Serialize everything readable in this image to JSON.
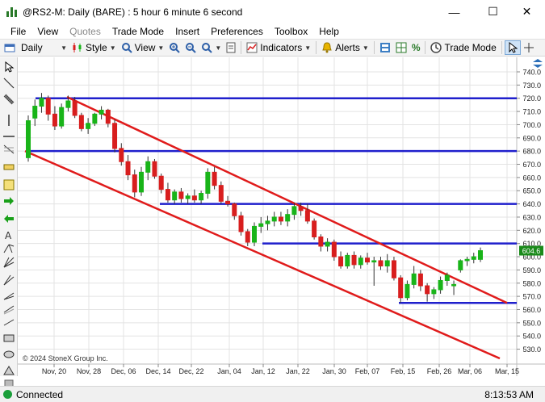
{
  "window": {
    "title": "@RS2-M: Daily (BARE) : 5 hour 6 minute 6 second",
    "minimize": "—",
    "maximize": "☐",
    "close": "✕"
  },
  "menu": [
    {
      "label": "File",
      "disabled": false
    },
    {
      "label": "View",
      "disabled": false
    },
    {
      "label": "Quotes",
      "disabled": true
    },
    {
      "label": "Trade Mode",
      "disabled": false
    },
    {
      "label": "Insert",
      "disabled": false
    },
    {
      "label": "Preferences",
      "disabled": false
    },
    {
      "label": "Toolbox",
      "disabled": false
    },
    {
      "label": "Help",
      "disabled": false
    }
  ],
  "toolbar": {
    "interval": "Daily",
    "style": "Style",
    "view": "View",
    "indicators": "Indicators",
    "alerts": "Alerts",
    "trade_mode": "Trade Mode"
  },
  "chart": {
    "copyright": "© 2024 StoneX Group Inc.",
    "last_price_label": "604.6",
    "colors": {
      "up": "#19b419",
      "down": "#d81e1e",
      "support_resistance": "#1f1fcc",
      "channel": "#e01b1b",
      "price_tag": "#1a8a1a"
    },
    "price_ticks": [
      "740.0",
      "730.0",
      "720.0",
      "710.0",
      "700.0",
      "690.0",
      "680.0",
      "670.0",
      "660.0",
      "650.0",
      "640.0",
      "630.0",
      "620.0",
      "610.0",
      "600.0",
      "590.0",
      "580.0",
      "570.0",
      "560.0",
      "550.0",
      "540.0",
      "530.0"
    ],
    "date_labels": [
      "Nov, 20",
      "Nov, 28",
      "Dec, 06",
      "Dec, 14",
      "Dec, 22",
      "Jan, 04",
      "Jan, 12",
      "Jan, 22",
      "Jan, 30",
      "Feb, 07",
      "Feb, 15",
      "Feb, 26",
      "Mar, 06",
      "Mar, 15"
    ]
  },
  "chart_data": {
    "type": "candlestick",
    "ylim": [
      525,
      745
    ],
    "horizontal_levels": [
      720,
      680,
      640,
      610,
      565
    ],
    "channel_lines": [
      {
        "from": [
          "Nov, 23",
          721
        ],
        "to": [
          "Mar, 15",
          565
        ]
      },
      {
        "from": [
          "Nov, 16",
          680
        ],
        "to": [
          "Mar, 13",
          523
        ]
      }
    ],
    "candles": [
      {
        "o": 675,
        "h": 707,
        "l": 672,
        "c": 703
      },
      {
        "o": 705,
        "h": 719,
        "l": 699,
        "c": 714
      },
      {
        "o": 714,
        "h": 724,
        "l": 709,
        "c": 720
      },
      {
        "o": 720,
        "h": 722,
        "l": 703,
        "c": 708
      },
      {
        "o": 708,
        "h": 714,
        "l": 696,
        "c": 699
      },
      {
        "o": 699,
        "h": 716,
        "l": 697,
        "c": 713
      },
      {
        "o": 713,
        "h": 722,
        "l": 710,
        "c": 718
      },
      {
        "o": 718,
        "h": 721,
        "l": 705,
        "c": 707
      },
      {
        "o": 707,
        "h": 709,
        "l": 695,
        "c": 697
      },
      {
        "o": 697,
        "h": 705,
        "l": 693,
        "c": 701
      },
      {
        "o": 701,
        "h": 709,
        "l": 699,
        "c": 708
      },
      {
        "o": 708,
        "h": 714,
        "l": 704,
        "c": 711
      },
      {
        "o": 711,
        "h": 712,
        "l": 698,
        "c": 701
      },
      {
        "o": 701,
        "h": 704,
        "l": 679,
        "c": 682
      },
      {
        "o": 682,
        "h": 686,
        "l": 669,
        "c": 672
      },
      {
        "o": 672,
        "h": 677,
        "l": 658,
        "c": 662
      },
      {
        "o": 662,
        "h": 666,
        "l": 645,
        "c": 649
      },
      {
        "o": 649,
        "h": 668,
        "l": 646,
        "c": 664
      },
      {
        "o": 664,
        "h": 676,
        "l": 658,
        "c": 672
      },
      {
        "o": 672,
        "h": 674,
        "l": 659,
        "c": 661
      },
      {
        "o": 661,
        "h": 663,
        "l": 648,
        "c": 651
      },
      {
        "o": 651,
        "h": 656,
        "l": 641,
        "c": 643
      },
      {
        "o": 643,
        "h": 651,
        "l": 640,
        "c": 649
      },
      {
        "o": 649,
        "h": 652,
        "l": 641,
        "c": 644
      },
      {
        "o": 644,
        "h": 648,
        "l": 640,
        "c": 646
      },
      {
        "o": 646,
        "h": 651,
        "l": 641,
        "c": 643
      },
      {
        "o": 643,
        "h": 650,
        "l": 640,
        "c": 648
      },
      {
        "o": 648,
        "h": 667,
        "l": 644,
        "c": 664
      },
      {
        "o": 664,
        "h": 668,
        "l": 651,
        "c": 654
      },
      {
        "o": 654,
        "h": 657,
        "l": 640,
        "c": 642
      },
      {
        "o": 642,
        "h": 646,
        "l": 638,
        "c": 640
      },
      {
        "o": 640,
        "h": 641,
        "l": 628,
        "c": 631
      },
      {
        "o": 631,
        "h": 634,
        "l": 616,
        "c": 619
      },
      {
        "o": 619,
        "h": 621,
        "l": 608,
        "c": 611
      },
      {
        "o": 611,
        "h": 626,
        "l": 608,
        "c": 623
      },
      {
        "o": 623,
        "h": 630,
        "l": 618,
        "c": 625
      },
      {
        "o": 625,
        "h": 631,
        "l": 620,
        "c": 627
      },
      {
        "o": 627,
        "h": 634,
        "l": 623,
        "c": 630
      },
      {
        "o": 630,
        "h": 634,
        "l": 624,
        "c": 627
      },
      {
        "o": 627,
        "h": 636,
        "l": 623,
        "c": 632
      },
      {
        "o": 632,
        "h": 641,
        "l": 628,
        "c": 638
      },
      {
        "o": 638,
        "h": 641,
        "l": 631,
        "c": 635
      },
      {
        "o": 635,
        "h": 640,
        "l": 625,
        "c": 627
      },
      {
        "o": 627,
        "h": 629,
        "l": 613,
        "c": 615
      },
      {
        "o": 615,
        "h": 617,
        "l": 604,
        "c": 608
      },
      {
        "o": 608,
        "h": 614,
        "l": 604,
        "c": 611
      },
      {
        "o": 611,
        "h": 613,
        "l": 597,
        "c": 600
      },
      {
        "o": 600,
        "h": 604,
        "l": 591,
        "c": 593
      },
      {
        "o": 593,
        "h": 603,
        "l": 591,
        "c": 601
      },
      {
        "o": 601,
        "h": 604,
        "l": 591,
        "c": 594
      },
      {
        "o": 594,
        "h": 601,
        "l": 591,
        "c": 599
      },
      {
        "o": 599,
        "h": 603,
        "l": 594,
        "c": 596
      },
      {
        "o": 596,
        "h": 600,
        "l": 578,
        "c": 597
      },
      {
        "o": 597,
        "h": 600,
        "l": 590,
        "c": 593
      },
      {
        "o": 593,
        "h": 602,
        "l": 588,
        "c": 597
      },
      {
        "o": 597,
        "h": 600,
        "l": 582,
        "c": 584
      },
      {
        "o": 584,
        "h": 586,
        "l": 565,
        "c": 569
      },
      {
        "o": 569,
        "h": 582,
        "l": 567,
        "c": 579
      },
      {
        "o": 579,
        "h": 593,
        "l": 576,
        "c": 587
      },
      {
        "o": 587,
        "h": 590,
        "l": 574,
        "c": 578
      },
      {
        "o": 578,
        "h": 580,
        "l": 566,
        "c": 572
      },
      {
        "o": 572,
        "h": 577,
        "l": 568,
        "c": 575
      },
      {
        "o": 575,
        "h": 585,
        "l": 572,
        "c": 582
      },
      {
        "o": 582,
        "h": 588,
        "l": 578,
        "c": 586
      },
      {
        "o": 578,
        "h": 582,
        "l": 571,
        "c": 579
      },
      {
        "o": 590,
        "h": 598,
        "l": 588,
        "c": 597
      },
      {
        "o": 597,
        "h": 600,
        "l": 593,
        "c": 598
      },
      {
        "o": 598,
        "h": 603,
        "l": 595,
        "c": 600
      },
      {
        "o": 598,
        "h": 607,
        "l": 596,
        "c": 604.6
      }
    ]
  },
  "status": {
    "connection": "Connected",
    "time": "8:13:53 AM"
  }
}
